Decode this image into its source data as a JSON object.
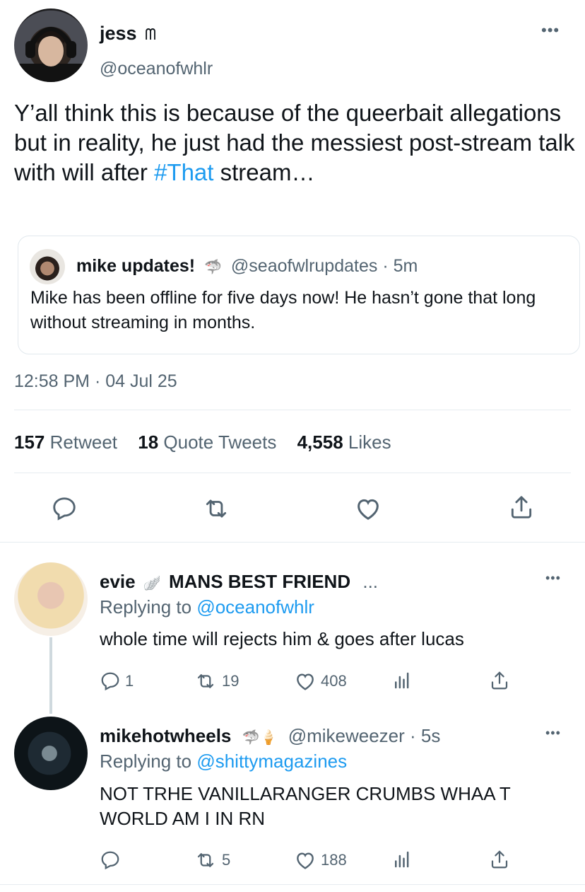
{
  "colors": {
    "accent": "#1d9bf0",
    "muted": "#536471",
    "text": "#0f1419",
    "divider": "#e6ecf0"
  },
  "tweet": {
    "author_name": "jess",
    "author_emoji": "ᗰ",
    "handle": "@oceanofwhlr",
    "more_icon": "•••",
    "text_before": "Y’all think this is because of the queerbait allegations but in reality, he just had the messiest post-stream talk with will after ",
    "hashtag": "#That",
    "text_after": " stream…",
    "timestamp": "12:58 PM · 04 Jul 25",
    "stats": {
      "retweets_num": "157",
      "retweets_label": "Retweet",
      "quotes_num": "18",
      "quotes_label": "Quote Tweets",
      "likes_num": "4,558",
      "likes_label": "Likes"
    }
  },
  "quoted": {
    "name": "mike updates!",
    "emoji": "🦈",
    "handle": "@seaofwlrupdates",
    "time": "· 5m",
    "text": "Mike has been offline for five days now! He hasn’t gone that long without streaming in months."
  },
  "replies": [
    {
      "name": "evie",
      "emoji": "🪽",
      "extra": "MANS BEST FRIEND",
      "ellipsis": "...",
      "replying_label": "Replying to",
      "replying_to": "@oceanofwhlr",
      "text": "whole time will rejects him & goes after lucas",
      "replies": "1",
      "retweets": "19",
      "likes": "408"
    },
    {
      "name": "mikehotwheels",
      "emoji": "🦈🍦",
      "handle": "@mikeweezer",
      "time": "· 5s",
      "replying_label": "Replying to",
      "replying_to": "@shittymagazines",
      "text_line1": "NOT TRHE VANILLARANGER CRUMBS WHAA T",
      "text_line2": "WORLD AM I IN RN",
      "replies": "",
      "retweets": "5",
      "likes": "188"
    }
  ]
}
